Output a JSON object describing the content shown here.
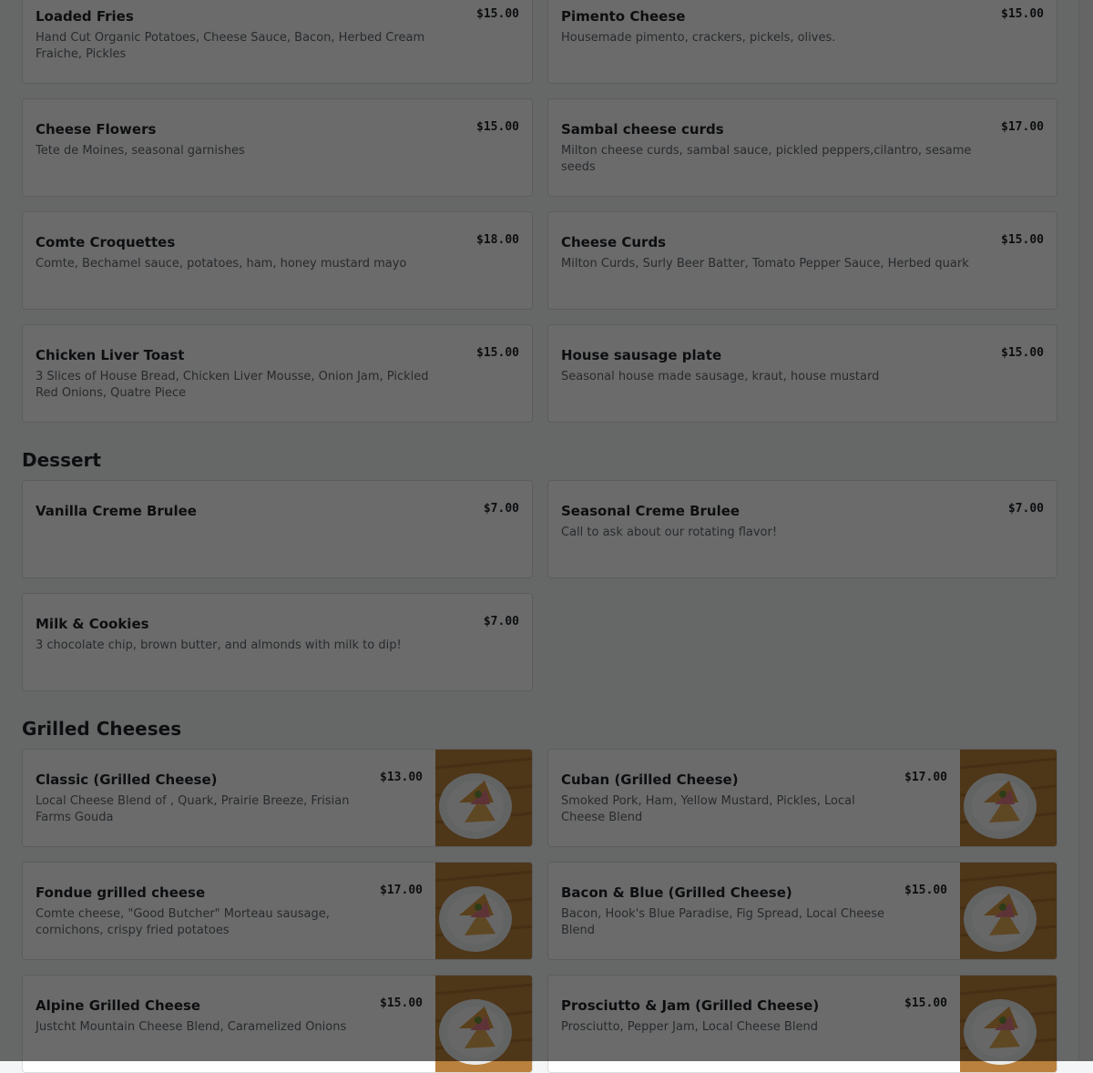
{
  "sections": {
    "dessert_title": "Dessert",
    "grilled_title": "Grilled Cheeses"
  },
  "top_items": [
    {
      "name": "Loaded Fries",
      "price": "$15.00",
      "desc": "Hand Cut Organic Potatoes, Cheese Sauce, Bacon, Herbed Cream Fraiche, Pickles"
    },
    {
      "name": "Pimento Cheese",
      "price": "$15.00",
      "desc": "Housemade pimento, crackers, pickels, olives."
    },
    {
      "name": "Cheese Flowers",
      "price": "$15.00",
      "desc": "Tete de Moines, seasonal garnishes"
    },
    {
      "name": "Sambal cheese curds",
      "price": "$17.00",
      "desc": "Milton cheese curds, sambal sauce, pickled peppers,cilantro, sesame seeds"
    },
    {
      "name": "Comte Croquettes",
      "price": "$18.00",
      "desc": "Comte, Bechamel sauce, potatoes, ham, honey mustard mayo"
    },
    {
      "name": "Cheese Curds",
      "price": "$15.00",
      "desc": "Milton Curds, Surly Beer Batter, Tomato Pepper Sauce, Herbed quark"
    },
    {
      "name": "Chicken Liver Toast",
      "price": "$15.00",
      "desc": "3 Slices of House Bread, Chicken Liver Mousse, Onion Jam, Pickled Red Onions, Quatre Piece"
    },
    {
      "name": "House sausage plate",
      "price": "$15.00",
      "desc": "Seasonal house made sausage, kraut, house mustard"
    }
  ],
  "dessert_items": [
    {
      "name": "Vanilla Creme Brulee",
      "price": "$7.00",
      "desc": ""
    },
    {
      "name": "Seasonal Creme Brulee",
      "price": "$7.00",
      "desc": "Call to ask about our rotating flavor!"
    },
    {
      "name": "Milk & Cookies",
      "price": "$7.00",
      "desc": "3 chocolate chip, brown butter, and almonds with milk to dip!"
    }
  ],
  "grilled_items": [
    {
      "name": "Classic (Grilled Cheese)",
      "price": "$13.00",
      "desc": "Local Cheese Blend of , Quark, Prairie Breeze, Frisian Farms Gouda"
    },
    {
      "name": "Cuban (Grilled Cheese)",
      "price": "$17.00",
      "desc": "Smoked Pork, Ham, Yellow Mustard, Pickles, Local Cheese Blend"
    },
    {
      "name": "Fondue grilled cheese",
      "price": "$17.00",
      "desc": "Comte cheese, \"Good Butcher\" Morteau sausage, cornichons, crispy fried potatoes"
    },
    {
      "name": "Bacon & Blue (Grilled Cheese)",
      "price": "$15.00",
      "desc": "Bacon, Hook's Blue Paradise, Fig Spread, Local Cheese Blend"
    },
    {
      "name": "Alpine Grilled Cheese",
      "price": "$15.00",
      "desc": "Justcht Mountain Cheese Blend, Caramelized Onions"
    },
    {
      "name": "Prosciutto & Jam (Grilled Cheese)",
      "price": "$15.00",
      "desc": "Prosciutto, Pepper Jam, Local Cheese Blend"
    }
  ],
  "icons": {
    "food_photo": "grilled-cheese-sandwich-photo"
  },
  "colors": {
    "overlay": "#000000",
    "card_bg": "#ffffff",
    "wood": "#b9813d"
  }
}
